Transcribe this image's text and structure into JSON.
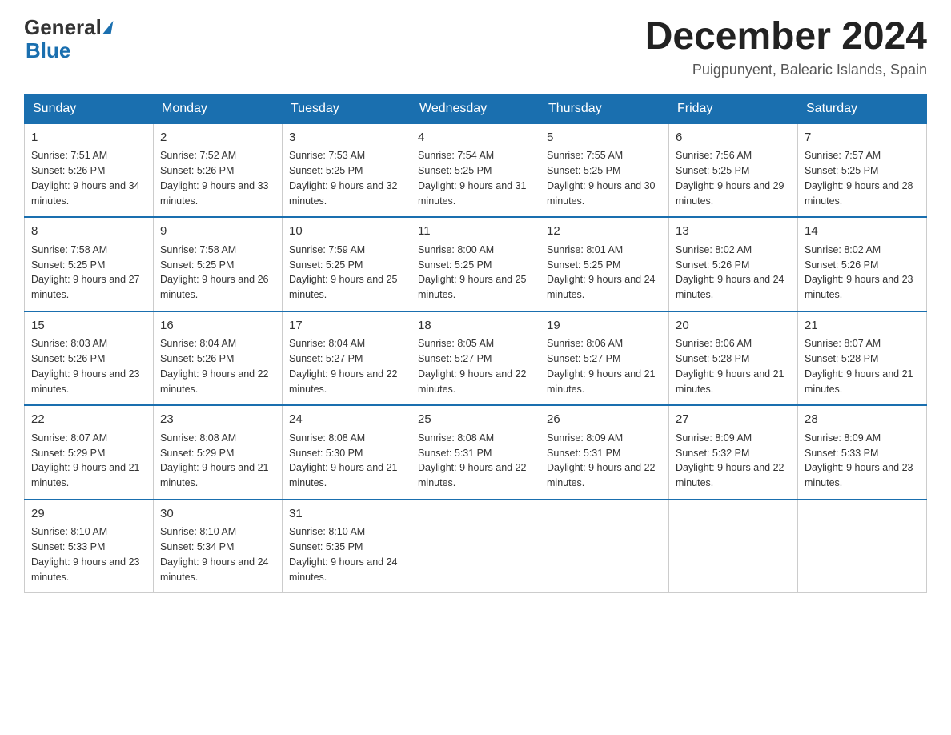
{
  "header": {
    "logo_general": "General",
    "logo_blue": "Blue",
    "month_title": "December 2024",
    "location": "Puigpunyent, Balearic Islands, Spain"
  },
  "weekdays": [
    "Sunday",
    "Monday",
    "Tuesday",
    "Wednesday",
    "Thursday",
    "Friday",
    "Saturday"
  ],
  "weeks": [
    [
      {
        "day": "1",
        "sunrise": "7:51 AM",
        "sunset": "5:26 PM",
        "daylight": "9 hours and 34 minutes."
      },
      {
        "day": "2",
        "sunrise": "7:52 AM",
        "sunset": "5:26 PM",
        "daylight": "9 hours and 33 minutes."
      },
      {
        "day": "3",
        "sunrise": "7:53 AM",
        "sunset": "5:25 PM",
        "daylight": "9 hours and 32 minutes."
      },
      {
        "day": "4",
        "sunrise": "7:54 AM",
        "sunset": "5:25 PM",
        "daylight": "9 hours and 31 minutes."
      },
      {
        "day": "5",
        "sunrise": "7:55 AM",
        "sunset": "5:25 PM",
        "daylight": "9 hours and 30 minutes."
      },
      {
        "day": "6",
        "sunrise": "7:56 AM",
        "sunset": "5:25 PM",
        "daylight": "9 hours and 29 minutes."
      },
      {
        "day": "7",
        "sunrise": "7:57 AM",
        "sunset": "5:25 PM",
        "daylight": "9 hours and 28 minutes."
      }
    ],
    [
      {
        "day": "8",
        "sunrise": "7:58 AM",
        "sunset": "5:25 PM",
        "daylight": "9 hours and 27 minutes."
      },
      {
        "day": "9",
        "sunrise": "7:58 AM",
        "sunset": "5:25 PM",
        "daylight": "9 hours and 26 minutes."
      },
      {
        "day": "10",
        "sunrise": "7:59 AM",
        "sunset": "5:25 PM",
        "daylight": "9 hours and 25 minutes."
      },
      {
        "day": "11",
        "sunrise": "8:00 AM",
        "sunset": "5:25 PM",
        "daylight": "9 hours and 25 minutes."
      },
      {
        "day": "12",
        "sunrise": "8:01 AM",
        "sunset": "5:25 PM",
        "daylight": "9 hours and 24 minutes."
      },
      {
        "day": "13",
        "sunrise": "8:02 AM",
        "sunset": "5:26 PM",
        "daylight": "9 hours and 24 minutes."
      },
      {
        "day": "14",
        "sunrise": "8:02 AM",
        "sunset": "5:26 PM",
        "daylight": "9 hours and 23 minutes."
      }
    ],
    [
      {
        "day": "15",
        "sunrise": "8:03 AM",
        "sunset": "5:26 PM",
        "daylight": "9 hours and 23 minutes."
      },
      {
        "day": "16",
        "sunrise": "8:04 AM",
        "sunset": "5:26 PM",
        "daylight": "9 hours and 22 minutes."
      },
      {
        "day": "17",
        "sunrise": "8:04 AM",
        "sunset": "5:27 PM",
        "daylight": "9 hours and 22 minutes."
      },
      {
        "day": "18",
        "sunrise": "8:05 AM",
        "sunset": "5:27 PM",
        "daylight": "9 hours and 22 minutes."
      },
      {
        "day": "19",
        "sunrise": "8:06 AM",
        "sunset": "5:27 PM",
        "daylight": "9 hours and 21 minutes."
      },
      {
        "day": "20",
        "sunrise": "8:06 AM",
        "sunset": "5:28 PM",
        "daylight": "9 hours and 21 minutes."
      },
      {
        "day": "21",
        "sunrise": "8:07 AM",
        "sunset": "5:28 PM",
        "daylight": "9 hours and 21 minutes."
      }
    ],
    [
      {
        "day": "22",
        "sunrise": "8:07 AM",
        "sunset": "5:29 PM",
        "daylight": "9 hours and 21 minutes."
      },
      {
        "day": "23",
        "sunrise": "8:08 AM",
        "sunset": "5:29 PM",
        "daylight": "9 hours and 21 minutes."
      },
      {
        "day": "24",
        "sunrise": "8:08 AM",
        "sunset": "5:30 PM",
        "daylight": "9 hours and 21 minutes."
      },
      {
        "day": "25",
        "sunrise": "8:08 AM",
        "sunset": "5:31 PM",
        "daylight": "9 hours and 22 minutes."
      },
      {
        "day": "26",
        "sunrise": "8:09 AM",
        "sunset": "5:31 PM",
        "daylight": "9 hours and 22 minutes."
      },
      {
        "day": "27",
        "sunrise": "8:09 AM",
        "sunset": "5:32 PM",
        "daylight": "9 hours and 22 minutes."
      },
      {
        "day": "28",
        "sunrise": "8:09 AM",
        "sunset": "5:33 PM",
        "daylight": "9 hours and 23 minutes."
      }
    ],
    [
      {
        "day": "29",
        "sunrise": "8:10 AM",
        "sunset": "5:33 PM",
        "daylight": "9 hours and 23 minutes."
      },
      {
        "day": "30",
        "sunrise": "8:10 AM",
        "sunset": "5:34 PM",
        "daylight": "9 hours and 24 minutes."
      },
      {
        "day": "31",
        "sunrise": "8:10 AM",
        "sunset": "5:35 PM",
        "daylight": "9 hours and 24 minutes."
      },
      null,
      null,
      null,
      null
    ]
  ],
  "labels": {
    "sunrise": "Sunrise:",
    "sunset": "Sunset:",
    "daylight": "Daylight:"
  }
}
